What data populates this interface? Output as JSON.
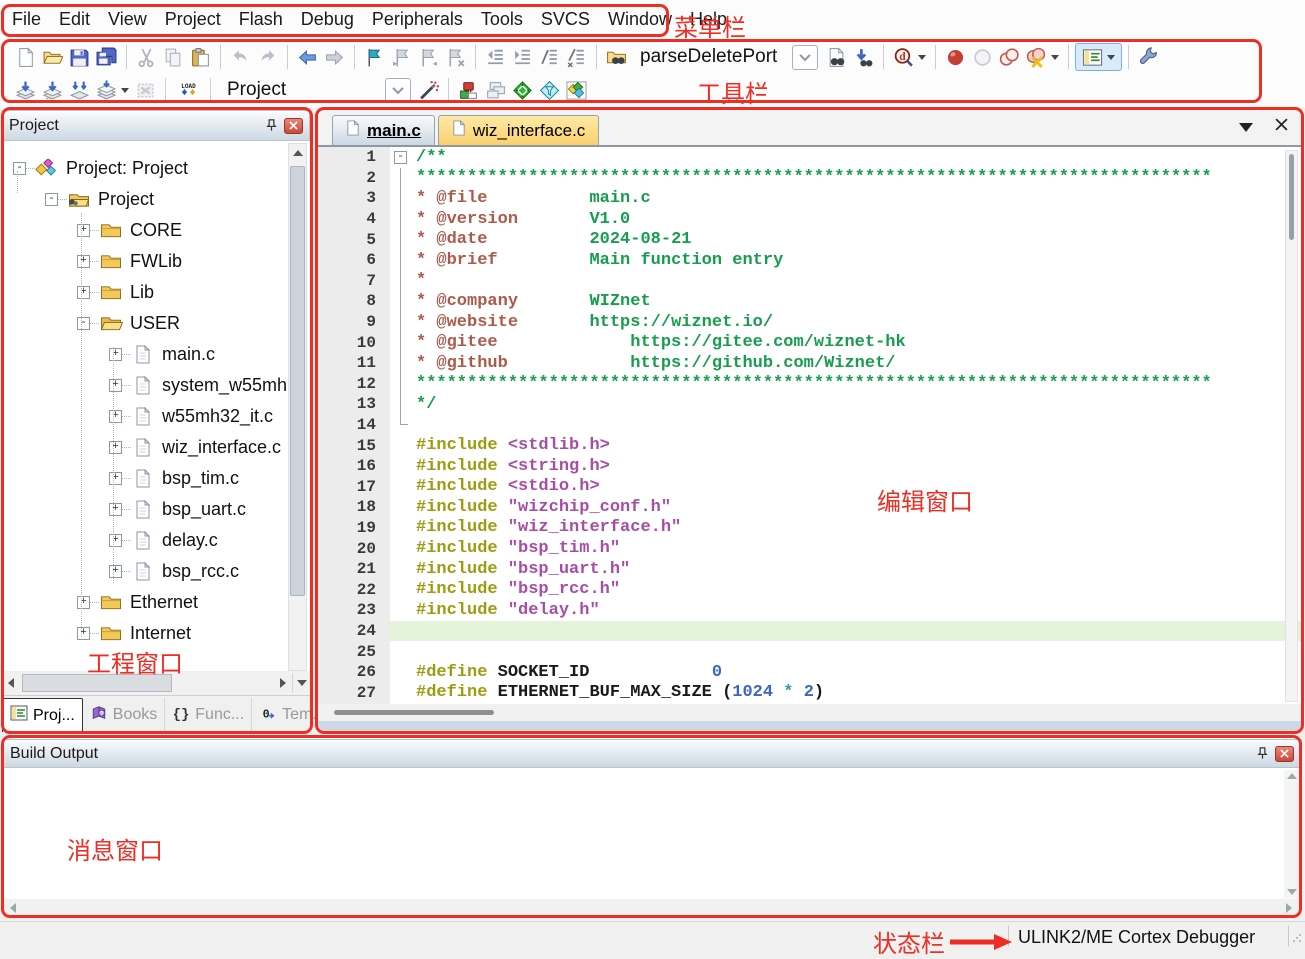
{
  "menu": {
    "items": [
      "File",
      "Edit",
      "View",
      "Project",
      "Flash",
      "Debug",
      "Peripherals",
      "Tools",
      "SVCS",
      "Window",
      "Help"
    ]
  },
  "toolbar": {
    "find_value": "parseDeletePort",
    "target_value": "Project"
  },
  "annotations": {
    "menu": "菜单栏",
    "toolbar": "工具栏",
    "project": "工程窗口",
    "editor": "编辑窗口",
    "output": "消息窗口",
    "status": "状态栏"
  },
  "project_panel": {
    "title": "Project",
    "tree": [
      {
        "label": "Project: Project",
        "level": 0,
        "exp": "-",
        "icon": "target"
      },
      {
        "label": "Project",
        "level": 1,
        "exp": "-",
        "icon": "foldergear"
      },
      {
        "label": "CORE",
        "level": 2,
        "exp": "+",
        "icon": "folder"
      },
      {
        "label": "FWLib",
        "level": 2,
        "exp": "+",
        "icon": "folder"
      },
      {
        "label": "Lib",
        "level": 2,
        "exp": "+",
        "icon": "folder"
      },
      {
        "label": "USER",
        "level": 2,
        "exp": "-",
        "icon": "folderopen"
      },
      {
        "label": "main.c",
        "level": 3,
        "exp": "+",
        "icon": "file"
      },
      {
        "label": "system_w55mh",
        "level": 3,
        "exp": "+",
        "icon": "file"
      },
      {
        "label": "w55mh32_it.c",
        "level": 3,
        "exp": "+",
        "icon": "file"
      },
      {
        "label": "wiz_interface.c",
        "level": 3,
        "exp": "+",
        "icon": "file"
      },
      {
        "label": "bsp_tim.c",
        "level": 3,
        "exp": "+",
        "icon": "file"
      },
      {
        "label": "bsp_uart.c",
        "level": 3,
        "exp": "+",
        "icon": "file"
      },
      {
        "label": "delay.c",
        "level": 3,
        "exp": "+",
        "icon": "file"
      },
      {
        "label": "bsp_rcc.c",
        "level": 3,
        "exp": "+",
        "icon": "file"
      },
      {
        "label": "Ethernet",
        "level": 2,
        "exp": "+",
        "icon": "folder"
      },
      {
        "label": "Internet",
        "level": 2,
        "exp": "+",
        "icon": "folder"
      }
    ],
    "tabs": [
      {
        "label": "Proj...",
        "icon": "proj",
        "active": true
      },
      {
        "label": "Books",
        "icon": "books",
        "active": false
      },
      {
        "label": "Func...",
        "icon": "func",
        "active": false
      },
      {
        "label": "Tem...",
        "icon": "tem",
        "active": false
      }
    ]
  },
  "editor": {
    "tabs": [
      {
        "label": "main.c",
        "active": true
      },
      {
        "label": "wiz_interface.c",
        "active": false
      }
    ],
    "lines": [
      {
        "fold": "box",
        "seg": [
          [
            "g",
            "/**"
          ]
        ]
      },
      {
        "fold": "v",
        "seg": [
          [
            "g",
            "******************************************************************************"
          ]
        ]
      },
      {
        "fold": "v",
        "seg": [
          [
            "t",
            "* @file"
          ],
          [
            "k",
            "          "
          ],
          [
            "g",
            "main.c"
          ]
        ]
      },
      {
        "fold": "v",
        "seg": [
          [
            "t",
            "* @version"
          ],
          [
            "k",
            "       "
          ],
          [
            "g",
            "V1.0"
          ]
        ]
      },
      {
        "fold": "v",
        "seg": [
          [
            "t",
            "* @date"
          ],
          [
            "k",
            "          "
          ],
          [
            "g",
            "2024-08-21"
          ]
        ]
      },
      {
        "fold": "v",
        "seg": [
          [
            "t",
            "* @brief"
          ],
          [
            "k",
            "         "
          ],
          [
            "g",
            "Main function entry"
          ]
        ]
      },
      {
        "fold": "v",
        "seg": [
          [
            "t",
            "*"
          ]
        ]
      },
      {
        "fold": "v",
        "seg": [
          [
            "t",
            "* @company"
          ],
          [
            "k",
            "       "
          ],
          [
            "g",
            "WIZnet"
          ]
        ]
      },
      {
        "fold": "v",
        "seg": [
          [
            "t",
            "* @website"
          ],
          [
            "k",
            "       "
          ],
          [
            "g",
            "https://wiznet.io/"
          ]
        ]
      },
      {
        "fold": "v",
        "seg": [
          [
            "t",
            "* @gitee"
          ],
          [
            "k",
            "             "
          ],
          [
            "g",
            "https://gitee.com/wiznet-hk"
          ]
        ]
      },
      {
        "fold": "v",
        "seg": [
          [
            "t",
            "* @github"
          ],
          [
            "k",
            "            "
          ],
          [
            "g",
            "https://github.com/Wiznet/"
          ]
        ]
      },
      {
        "fold": "v",
        "seg": [
          [
            "g",
            "******************************************************************************"
          ]
        ]
      },
      {
        "fold": "v",
        "seg": [
          [
            "g",
            "*/"
          ]
        ]
      },
      {
        "fold": "corner",
        "seg": []
      },
      {
        "seg": [
          [
            "o",
            "#include "
          ],
          [
            "p",
            "<stdlib.h>"
          ]
        ]
      },
      {
        "seg": [
          [
            "o",
            "#include "
          ],
          [
            "p",
            "<string.h>"
          ]
        ]
      },
      {
        "seg": [
          [
            "o",
            "#include "
          ],
          [
            "p",
            "<stdio.h>"
          ]
        ]
      },
      {
        "seg": [
          [
            "o",
            "#include "
          ],
          [
            "p",
            "\"wizchip_conf.h\""
          ]
        ]
      },
      {
        "seg": [
          [
            "o",
            "#include "
          ],
          [
            "p",
            "\"wiz_interface.h\""
          ]
        ]
      },
      {
        "seg": [
          [
            "o",
            "#include "
          ],
          [
            "p",
            "\"bsp_tim.h\""
          ]
        ]
      },
      {
        "seg": [
          [
            "o",
            "#include "
          ],
          [
            "p",
            "\"bsp_uart.h\""
          ]
        ]
      },
      {
        "seg": [
          [
            "o",
            "#include "
          ],
          [
            "p",
            "\"bsp_rcc.h\""
          ]
        ]
      },
      {
        "seg": [
          [
            "o",
            "#include "
          ],
          [
            "p",
            "\"delay.h\""
          ]
        ]
      },
      {
        "hl": true,
        "seg": []
      },
      {
        "seg": []
      },
      {
        "seg": [
          [
            "o",
            "#define "
          ],
          [
            "k",
            "SOCKET_ID"
          ],
          [
            "k",
            "            "
          ],
          [
            "n",
            "0"
          ]
        ]
      },
      {
        "seg": [
          [
            "o",
            "#define "
          ],
          [
            "k",
            "ETHERNET_BUF_MAX_SIZE "
          ],
          [
            "k",
            "("
          ],
          [
            "n",
            "1024"
          ],
          [
            "k",
            " "
          ],
          [
            "l",
            "*"
          ],
          [
            "k",
            " "
          ],
          [
            "n",
            "2"
          ],
          [
            "k",
            ")"
          ]
        ]
      }
    ]
  },
  "build_output": {
    "title": "Build Output"
  },
  "status_bar": {
    "debugger": "ULINK2/ME Cortex Debugger"
  }
}
